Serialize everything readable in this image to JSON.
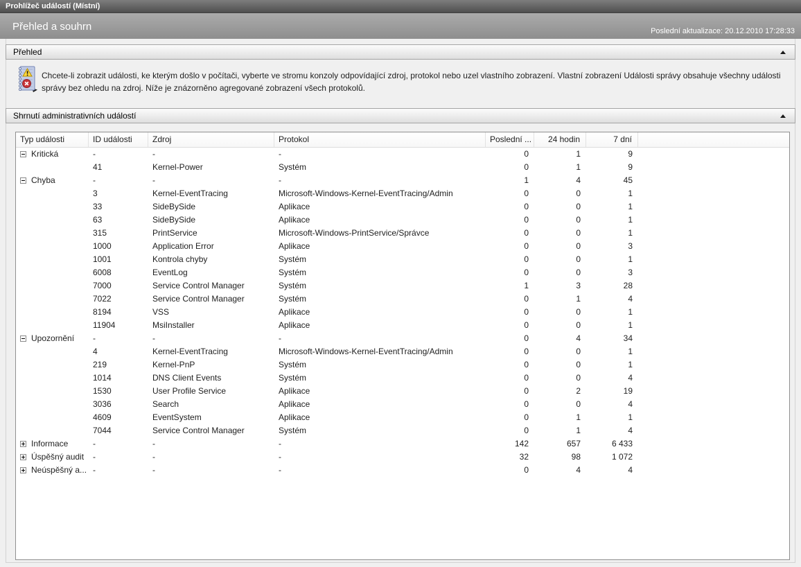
{
  "window": {
    "title": "Prohlížeč událostí (Místní)"
  },
  "page_header": {
    "title": "Přehled a souhrn",
    "last_update": "Poslední aktualizace: 20.12.2010 17:28:33"
  },
  "overview": {
    "header": "Přehled",
    "icon": "event-log-icon",
    "collapse_icon": "chevron-up-icon",
    "description": "Chcete-li zobrazit události, ke kterým došlo v počítači, vyberte ve stromu konzoly odpovídající zdroj, protokol nebo uzel vlastního zobrazení. Vlastní zobrazení Události správy obsahuje všechny události správy bez ohledu na zdroj. Níže je znázorněno agregované zobrazení všech protokolů."
  },
  "summary": {
    "header": "Shrnutí administrativních událostí",
    "collapse_icon": "chevron-up-icon",
    "table": {
      "columns": [
        "Typ události",
        "ID události",
        "Zdroj",
        "Protokol",
        "Poslední ...",
        "24 hodin",
        "7 dní"
      ],
      "rows": [
        {
          "expander": "minus",
          "event_type": "Kritická",
          "id": "-",
          "source": "-",
          "log": "-",
          "last": "0",
          "h24": "1",
          "d7": "9"
        },
        {
          "expander": null,
          "event_type": "",
          "id": "41",
          "source": "Kernel-Power",
          "log": "Systém",
          "last": "0",
          "h24": "1",
          "d7": "9"
        },
        {
          "expander": "minus",
          "event_type": "Chyba",
          "id": "-",
          "source": "-",
          "log": "-",
          "last": "1",
          "h24": "4",
          "d7": "45"
        },
        {
          "expander": null,
          "event_type": "",
          "id": "3",
          "source": "Kernel-EventTracing",
          "log": "Microsoft-Windows-Kernel-EventTracing/Admin",
          "last": "0",
          "h24": "0",
          "d7": "1"
        },
        {
          "expander": null,
          "event_type": "",
          "id": "33",
          "source": "SideBySide",
          "log": "Aplikace",
          "last": "0",
          "h24": "0",
          "d7": "1"
        },
        {
          "expander": null,
          "event_type": "",
          "id": "63",
          "source": "SideBySide",
          "log": "Aplikace",
          "last": "0",
          "h24": "0",
          "d7": "1"
        },
        {
          "expander": null,
          "event_type": "",
          "id": "315",
          "source": "PrintService",
          "log": "Microsoft-Windows-PrintService/Správce",
          "last": "0",
          "h24": "0",
          "d7": "1"
        },
        {
          "expander": null,
          "event_type": "",
          "id": "1000",
          "source": "Application Error",
          "log": "Aplikace",
          "last": "0",
          "h24": "0",
          "d7": "3"
        },
        {
          "expander": null,
          "event_type": "",
          "id": "1001",
          "source": "Kontrola chyby",
          "log": "Systém",
          "last": "0",
          "h24": "0",
          "d7": "1"
        },
        {
          "expander": null,
          "event_type": "",
          "id": "6008",
          "source": "EventLog",
          "log": "Systém",
          "last": "0",
          "h24": "0",
          "d7": "3"
        },
        {
          "expander": null,
          "event_type": "",
          "id": "7000",
          "source": "Service Control Manager",
          "log": "Systém",
          "last": "1",
          "h24": "3",
          "d7": "28"
        },
        {
          "expander": null,
          "event_type": "",
          "id": "7022",
          "source": "Service Control Manager",
          "log": "Systém",
          "last": "0",
          "h24": "1",
          "d7": "4"
        },
        {
          "expander": null,
          "event_type": "",
          "id": "8194",
          "source": "VSS",
          "log": "Aplikace",
          "last": "0",
          "h24": "0",
          "d7": "1"
        },
        {
          "expander": null,
          "event_type": "",
          "id": "11904",
          "source": "MsiInstaller",
          "log": "Aplikace",
          "last": "0",
          "h24": "0",
          "d7": "1"
        },
        {
          "expander": "minus",
          "event_type": "Upozornění",
          "id": "-",
          "source": "-",
          "log": "-",
          "last": "0",
          "h24": "4",
          "d7": "34"
        },
        {
          "expander": null,
          "event_type": "",
          "id": "4",
          "source": "Kernel-EventTracing",
          "log": "Microsoft-Windows-Kernel-EventTracing/Admin",
          "last": "0",
          "h24": "0",
          "d7": "1"
        },
        {
          "expander": null,
          "event_type": "",
          "id": "219",
          "source": "Kernel-PnP",
          "log": "Systém",
          "last": "0",
          "h24": "0",
          "d7": "1"
        },
        {
          "expander": null,
          "event_type": "",
          "id": "1014",
          "source": "DNS Client Events",
          "log": "Systém",
          "last": "0",
          "h24": "0",
          "d7": "4"
        },
        {
          "expander": null,
          "event_type": "",
          "id": "1530",
          "source": "User Profile Service",
          "log": "Aplikace",
          "last": "0",
          "h24": "2",
          "d7": "19"
        },
        {
          "expander": null,
          "event_type": "",
          "id": "3036",
          "source": "Search",
          "log": "Aplikace",
          "last": "0",
          "h24": "0",
          "d7": "4"
        },
        {
          "expander": null,
          "event_type": "",
          "id": "4609",
          "source": "EventSystem",
          "log": "Aplikace",
          "last": "0",
          "h24": "1",
          "d7": "1"
        },
        {
          "expander": null,
          "event_type": "",
          "id": "7044",
          "source": "Service Control Manager",
          "log": "Systém",
          "last": "0",
          "h24": "1",
          "d7": "4"
        },
        {
          "expander": "plus",
          "event_type": "Informace",
          "id": "-",
          "source": "-",
          "log": "-",
          "last": "142",
          "h24": "657",
          "d7": "6 433"
        },
        {
          "expander": "plus",
          "event_type": "Úspěšný audit",
          "id": "-",
          "source": "-",
          "log": "-",
          "last": "32",
          "h24": "98",
          "d7": "1 072"
        },
        {
          "expander": "plus",
          "event_type": "Neúspěšný a...",
          "id": "-",
          "source": "-",
          "log": "-",
          "last": "0",
          "h24": "4",
          "d7": "4"
        }
      ]
    }
  }
}
